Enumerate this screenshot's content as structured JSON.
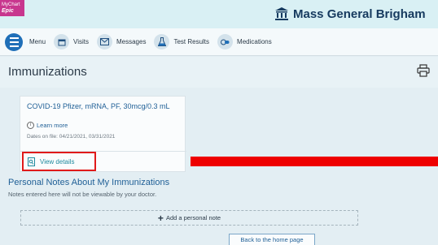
{
  "colors": {
    "accent": "#1f6fb8",
    "highlight_box": "#e01a1a",
    "red_bar": "#ee0000",
    "brand": "#163a5f",
    "logo_bg": "#c8368e"
  },
  "header": {
    "logo_line1": "MyChart",
    "logo_line2": "Epic",
    "brand_name": "Mass General Brigham",
    "brand_icon": "building-icon"
  },
  "nav": {
    "items": [
      {
        "label": "Menu",
        "icon": "hamburger-icon"
      },
      {
        "label": "Visits",
        "icon": "calendar-icon"
      },
      {
        "label": "Messages",
        "icon": "envelope-icon"
      },
      {
        "label": "Test Results",
        "icon": "flask-icon"
      },
      {
        "label": "Medications",
        "icon": "pills-icon"
      }
    ]
  },
  "page": {
    "title": "Immunizations",
    "print_icon": "printer-icon"
  },
  "card": {
    "title": "COVID-19 Pfizer, mRNA, PF, 30mcg/0.3 mL",
    "learn_more": "Learn more",
    "dates": "Dates on file: 04/21/2021, 03/31/2021",
    "view_details": "View details"
  },
  "notes": {
    "heading": "Personal Notes About My Immunizations",
    "subtext": "Notes entered here will not be viewable by your doctor.",
    "add_label": "Add a personal note"
  },
  "footer": {
    "home_button": "Back to the home page"
  }
}
